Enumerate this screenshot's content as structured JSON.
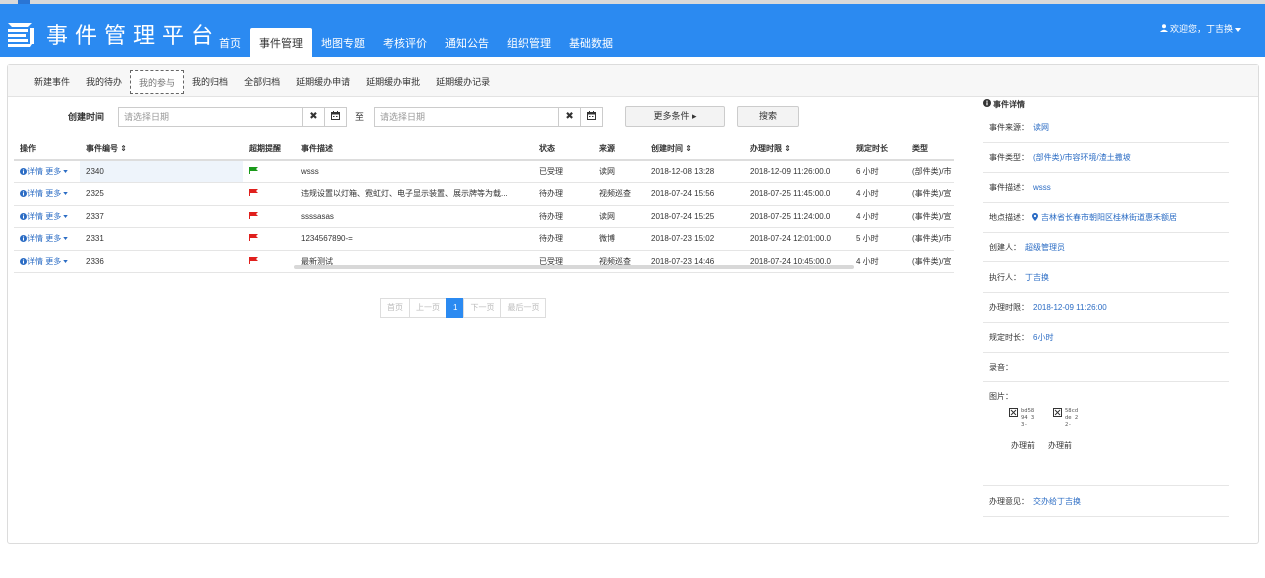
{
  "app": {
    "title": "事件管理平台",
    "user_greeting": "欢迎您，丁吉换"
  },
  "nav": {
    "items": [
      {
        "label": "首页"
      },
      {
        "label": "事件管理"
      },
      {
        "label": "地图专题"
      },
      {
        "label": "考核评价"
      },
      {
        "label": "通知公告"
      },
      {
        "label": "组织管理"
      },
      {
        "label": "基础数据"
      }
    ],
    "active_index": 1
  },
  "subtabs": {
    "items": [
      {
        "label": "新建事件"
      },
      {
        "label": "我的待办"
      },
      {
        "label": "我的参与"
      },
      {
        "label": "我的归档"
      },
      {
        "label": "全部归档"
      },
      {
        "label": "延期缓办申请"
      },
      {
        "label": "延期缓办审批"
      },
      {
        "label": "延期缓办记录"
      }
    ],
    "active_index": 2
  },
  "filter": {
    "label": "创建时间",
    "start_placeholder": "请选择日期",
    "to_label": "至",
    "end_placeholder": "请选择日期",
    "more_label": "更多条件 ▸",
    "search_label": "搜索"
  },
  "table": {
    "headers": [
      "操作",
      "事件编号 ⇕",
      "超期提醒",
      "事件描述",
      "状态",
      "来源",
      "创建时间 ⇕",
      "办理时限 ⇕",
      "规定时长",
      "类型"
    ],
    "op_detail": "详情",
    "op_more": "更多",
    "rows": [
      {
        "id": "2340",
        "flag": "green",
        "desc": "wsss",
        "status": "已受理",
        "source": "读网",
        "created": "2018-12-08 13:28",
        "deadline": "2018-12-09 11:26:00.0",
        "duration": "6 小时",
        "type": "(部件类)/市"
      },
      {
        "id": "2325",
        "flag": "red",
        "desc": "违规设置以灯箱、霓虹灯、电子显示装置、展示牌等为载...",
        "status": "待办理",
        "source": "视频巡查",
        "created": "2018-07-24 15:56",
        "deadline": "2018-07-25 11:45:00.0",
        "duration": "4 小时",
        "type": "(事件类)/宣"
      },
      {
        "id": "2337",
        "flag": "red",
        "desc": "ssssasas",
        "status": "待办理",
        "source": "读网",
        "created": "2018-07-24 15:25",
        "deadline": "2018-07-25 11:24:00.0",
        "duration": "4 小时",
        "type": "(事件类)/宣"
      },
      {
        "id": "2331",
        "flag": "red",
        "desc": "1234567890-=",
        "status": "待办理",
        "source": "微博",
        "created": "2018-07-23 15:02",
        "deadline": "2018-07-24 12:01:00.0",
        "duration": "5 小时",
        "type": "(事件类)/市"
      },
      {
        "id": "2336",
        "flag": "red",
        "desc": "最新测试",
        "status": "已受理",
        "source": "视频巡查",
        "created": "2018-07-23 14:46",
        "deadline": "2018-07-24 10:45:00.0",
        "duration": "4 小时",
        "type": "(事件类)/宣"
      }
    ]
  },
  "pager": {
    "first": "首页",
    "prev": "上一页",
    "current": "1",
    "next": "下一页",
    "last": "最后一页"
  },
  "detail": {
    "title": "事件详情",
    "source_label": "事件来源：",
    "source_value": "读网",
    "type_label": "事件类型：",
    "type_value": "(部件类)/市容环境/渣土撒坡",
    "desc_label": "事件描述：",
    "desc_value": "wsss",
    "location_label": "地点描述：",
    "location_value": "吉林省长春市朝阳区桂林街道惠禾额居",
    "creator_label": "创建人：",
    "creator_value": "超级管理员",
    "executor_label": "执行人：",
    "executor_value": "丁吉换",
    "deadline_label": "办理时限：",
    "deadline_value": "2018-12-09 11:26:00",
    "duration_label": "规定时长：",
    "duration_value": "6小时",
    "recording_label": "录音：",
    "images_label": "图片：",
    "images": [
      {
        "alt": "bd5894 33-",
        "caption": "办理前"
      },
      {
        "alt": "58cdde 22-",
        "caption": "办理前"
      }
    ],
    "opinion_label": "办理意见：",
    "opinion_value": "交办给丁吉换"
  },
  "colors": {
    "header": "#2b8af1",
    "link": "#2b6cc4",
    "flag_green": "#1a9a1a",
    "flag_red": "#e0201d"
  }
}
